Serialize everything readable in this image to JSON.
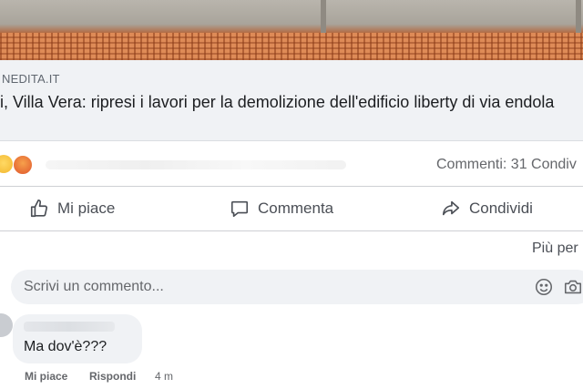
{
  "link": {
    "domain": "NEDITA.IT",
    "headline": "i, Villa Vera: ripresi i lavori per la demolizione dell'edificio liberty di via endola"
  },
  "reactions": {
    "icons": [
      "sad-emoji",
      "angry-emoji"
    ],
    "counts_text": "Commenti: 31  Condiv"
  },
  "actions": {
    "like_label": "Mi piace",
    "comment_label": "Commenta",
    "share_label": "Condividi"
  },
  "more_label": "Più per",
  "comment_box": {
    "placeholder": "Scrivi un commento..."
  },
  "comment": {
    "text": "Ma dov'è???",
    "like_label": "Mi piace",
    "reply_label": "Rispondi",
    "time": "4 m"
  }
}
